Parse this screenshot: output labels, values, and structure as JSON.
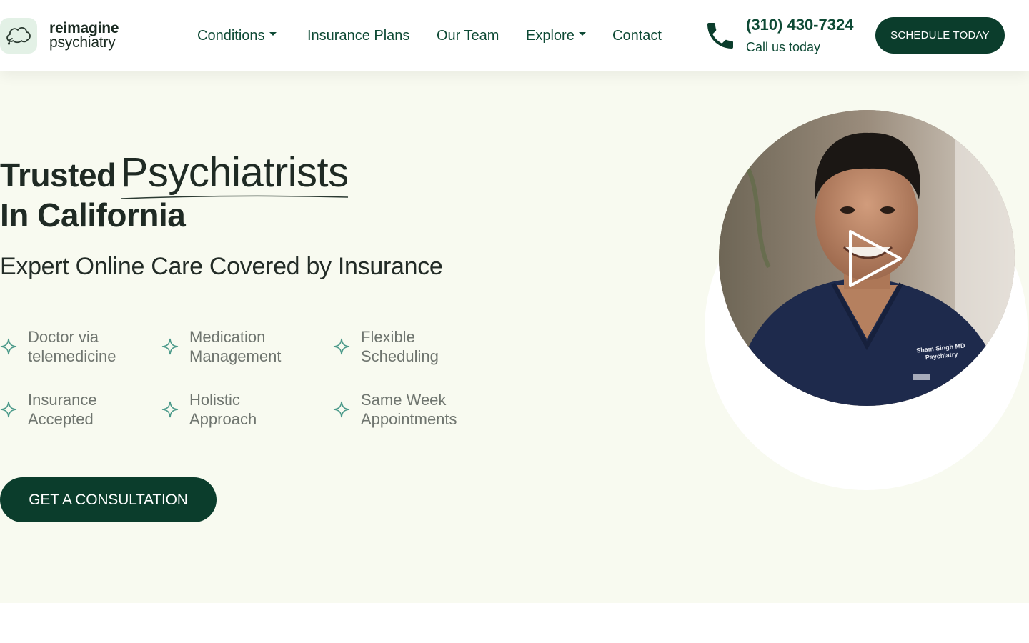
{
  "brand": {
    "line1": "reimagine",
    "line2": "psychiatry",
    "logo_icon": "brain-cloud-icon",
    "accent_color": "#0b3d2c"
  },
  "nav": {
    "items": [
      {
        "label": "Conditions",
        "has_dropdown": true
      },
      {
        "label": "Insurance Plans",
        "has_dropdown": false
      },
      {
        "label": "Our Team",
        "has_dropdown": false
      },
      {
        "label": "Explore",
        "has_dropdown": true
      },
      {
        "label": "Contact",
        "has_dropdown": false
      }
    ]
  },
  "contact": {
    "phone": "(310) 430-7324",
    "caption": "Call us today",
    "icon": "phone-icon"
  },
  "header_cta": {
    "label": "SCHEDULE TODAY"
  },
  "hero": {
    "title_word1": "Trusted",
    "title_word2": "Psychiatrists",
    "title_line2": "In California",
    "subheading": "Expert Online Care Covered by Insurance",
    "features": [
      {
        "text": "Doctor via\ntelemedicine"
      },
      {
        "text": "Medication\nManagement"
      },
      {
        "text": "Flexible\nScheduling"
      },
      {
        "text": "Insurance\nAccepted"
      },
      {
        "text": "Holistic\nApproach"
      },
      {
        "text": "Same Week\nAppointments"
      }
    ],
    "cta_label": "GET A CONSULTATION",
    "background_color": "#f8faf0"
  },
  "video": {
    "badge_text": "Sham Singh MD\nPsychiatry",
    "play_icon": "play-icon"
  }
}
